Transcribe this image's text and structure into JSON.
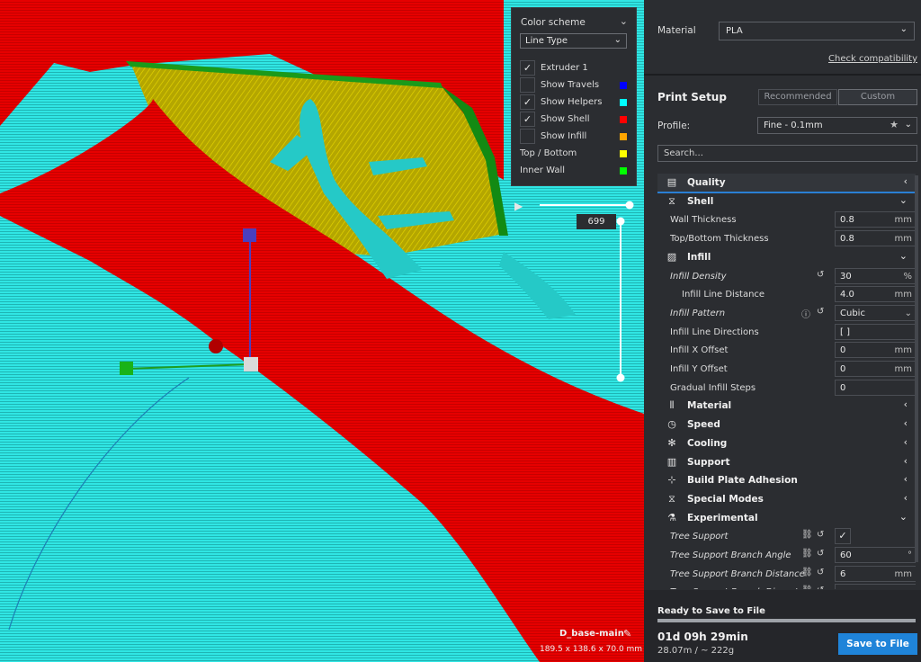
{
  "viewport": {
    "color_scheme_panel": {
      "title": "Color scheme",
      "scheme_value": "Line Type",
      "options": [
        {
          "label": "Extruder 1",
          "checked": true,
          "swatch": null
        },
        {
          "label": "Show Travels",
          "checked": false,
          "swatch": "#0000ff"
        },
        {
          "label": "Show Helpers",
          "checked": true,
          "swatch": "#00ffff"
        },
        {
          "label": "Show Shell",
          "checked": true,
          "swatch": "#ff0000"
        },
        {
          "label": "Show Infill",
          "checked": false,
          "swatch": "#ffa500"
        }
      ],
      "legend": [
        {
          "label": "Top / Bottom",
          "swatch": "#ffff00"
        },
        {
          "label": "Inner Wall",
          "swatch": "#00ff00"
        }
      ]
    },
    "layer_value": "699",
    "model_name": "D_base-main",
    "model_dimensions": "189.5 x 138.6 x 70.0 mm",
    "colors": {
      "shell": "#e60000",
      "helpers": "#2ee8e6",
      "top_bottom": "#b8a800",
      "inner_wall": "#00cc00"
    }
  },
  "sidebar": {
    "material_label": "Material",
    "material_value": "PLA",
    "check_compatibility": "Check compatibility",
    "print_setup_title": "Print Setup",
    "mode_recommended": "Recommended",
    "mode_custom": "Custom",
    "profile_label": "Profile:",
    "profile_value": "Fine - 0.1mm",
    "search_placeholder": "Search...",
    "settings": [
      {
        "kind": "cat",
        "icon": "quality-icon",
        "glyph": "▤",
        "label": "Quality",
        "chevron": "‹",
        "active": true
      },
      {
        "kind": "cat",
        "icon": "shell-icon",
        "glyph": "⧖",
        "label": "Shell",
        "chevron": "⌄"
      },
      {
        "kind": "setting",
        "label": "Wall Thickness",
        "value": "0.8",
        "unit": "mm"
      },
      {
        "kind": "setting",
        "label": "Top/Bottom Thickness",
        "value": "0.8",
        "unit": "mm"
      },
      {
        "kind": "cat",
        "icon": "infill-icon",
        "glyph": "▨",
        "label": "Infill",
        "chevron": "⌄"
      },
      {
        "kind": "setting",
        "label": "Infill Density",
        "value": "30",
        "unit": "%",
        "italic": true,
        "reset": true
      },
      {
        "kind": "setting",
        "label": "Infill Line Distance",
        "value": "4.0",
        "unit": "mm",
        "indent": true
      },
      {
        "kind": "dropdown",
        "label": "Infill Pattern",
        "value": "Cubic",
        "italic": true,
        "reset": true,
        "info": true
      },
      {
        "kind": "setting",
        "label": "Infill Line Directions",
        "value": "[ ]",
        "unit": ""
      },
      {
        "kind": "setting",
        "label": "Infill X Offset",
        "value": "0",
        "unit": "mm"
      },
      {
        "kind": "setting",
        "label": "Infill Y Offset",
        "value": "0",
        "unit": "mm"
      },
      {
        "kind": "setting",
        "label": "Gradual Infill Steps",
        "value": "0",
        "unit": ""
      },
      {
        "kind": "cat",
        "icon": "material-icon",
        "glyph": "⦀",
        "label": "Material",
        "chevron": "‹"
      },
      {
        "kind": "cat",
        "icon": "speed-icon",
        "glyph": "◷",
        "label": "Speed",
        "chevron": "‹"
      },
      {
        "kind": "cat",
        "icon": "cooling-icon",
        "glyph": "✻",
        "label": "Cooling",
        "chevron": "‹"
      },
      {
        "kind": "cat",
        "icon": "support-icon",
        "glyph": "▥",
        "label": "Support",
        "chevron": "‹"
      },
      {
        "kind": "cat",
        "icon": "adhesion-icon",
        "glyph": "⊹",
        "label": "Build Plate Adhesion",
        "chevron": "‹"
      },
      {
        "kind": "cat",
        "icon": "special-modes-icon",
        "glyph": "⧖",
        "label": "Special Modes",
        "chevron": "‹"
      },
      {
        "kind": "cat",
        "icon": "experimental-icon",
        "glyph": "⚗",
        "label": "Experimental",
        "chevron": "⌄"
      },
      {
        "kind": "checkbox",
        "label": "Tree Support",
        "checked": true,
        "italic": true,
        "link": true,
        "reset": true
      },
      {
        "kind": "setting",
        "label": "Tree Support Branch Angle",
        "value": "60",
        "unit": "°",
        "italic": true,
        "link": true,
        "reset": true
      },
      {
        "kind": "setting",
        "label": "Tree Support Branch Distance",
        "value": "6",
        "unit": "mm",
        "italic": true,
        "link": true,
        "reset": true
      },
      {
        "kind": "setting",
        "label": "Tree Support Branch Diameter",
        "value": "",
        "unit": "",
        "italic": true,
        "link": true,
        "reset": true
      }
    ],
    "bottom": {
      "status": "Ready to Save to File",
      "progress": 1.0,
      "print_time": "01d 09h 29min",
      "material_estimate": "28.07m / ~ 222g",
      "save_button": "Save to File"
    }
  }
}
